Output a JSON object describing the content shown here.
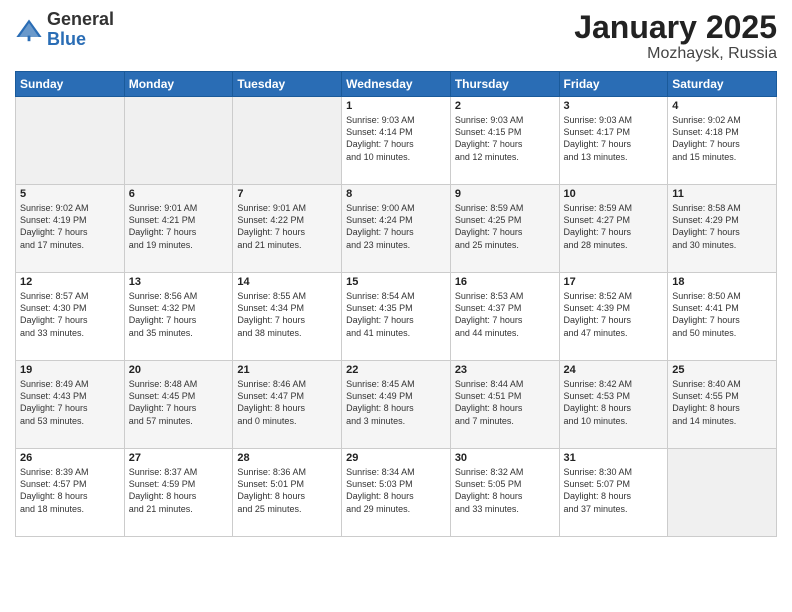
{
  "header": {
    "logo_general": "General",
    "logo_blue": "Blue",
    "month": "January 2025",
    "location": "Mozhaysk, Russia"
  },
  "weekdays": [
    "Sunday",
    "Monday",
    "Tuesday",
    "Wednesday",
    "Thursday",
    "Friday",
    "Saturday"
  ],
  "weeks": [
    [
      {
        "day": "",
        "info": ""
      },
      {
        "day": "",
        "info": ""
      },
      {
        "day": "",
        "info": ""
      },
      {
        "day": "1",
        "info": "Sunrise: 9:03 AM\nSunset: 4:14 PM\nDaylight: 7 hours\nand 10 minutes."
      },
      {
        "day": "2",
        "info": "Sunrise: 9:03 AM\nSunset: 4:15 PM\nDaylight: 7 hours\nand 12 minutes."
      },
      {
        "day": "3",
        "info": "Sunrise: 9:03 AM\nSunset: 4:17 PM\nDaylight: 7 hours\nand 13 minutes."
      },
      {
        "day": "4",
        "info": "Sunrise: 9:02 AM\nSunset: 4:18 PM\nDaylight: 7 hours\nand 15 minutes."
      }
    ],
    [
      {
        "day": "5",
        "info": "Sunrise: 9:02 AM\nSunset: 4:19 PM\nDaylight: 7 hours\nand 17 minutes."
      },
      {
        "day": "6",
        "info": "Sunrise: 9:01 AM\nSunset: 4:21 PM\nDaylight: 7 hours\nand 19 minutes."
      },
      {
        "day": "7",
        "info": "Sunrise: 9:01 AM\nSunset: 4:22 PM\nDaylight: 7 hours\nand 21 minutes."
      },
      {
        "day": "8",
        "info": "Sunrise: 9:00 AM\nSunset: 4:24 PM\nDaylight: 7 hours\nand 23 minutes."
      },
      {
        "day": "9",
        "info": "Sunrise: 8:59 AM\nSunset: 4:25 PM\nDaylight: 7 hours\nand 25 minutes."
      },
      {
        "day": "10",
        "info": "Sunrise: 8:59 AM\nSunset: 4:27 PM\nDaylight: 7 hours\nand 28 minutes."
      },
      {
        "day": "11",
        "info": "Sunrise: 8:58 AM\nSunset: 4:29 PM\nDaylight: 7 hours\nand 30 minutes."
      }
    ],
    [
      {
        "day": "12",
        "info": "Sunrise: 8:57 AM\nSunset: 4:30 PM\nDaylight: 7 hours\nand 33 minutes."
      },
      {
        "day": "13",
        "info": "Sunrise: 8:56 AM\nSunset: 4:32 PM\nDaylight: 7 hours\nand 35 minutes."
      },
      {
        "day": "14",
        "info": "Sunrise: 8:55 AM\nSunset: 4:34 PM\nDaylight: 7 hours\nand 38 minutes."
      },
      {
        "day": "15",
        "info": "Sunrise: 8:54 AM\nSunset: 4:35 PM\nDaylight: 7 hours\nand 41 minutes."
      },
      {
        "day": "16",
        "info": "Sunrise: 8:53 AM\nSunset: 4:37 PM\nDaylight: 7 hours\nand 44 minutes."
      },
      {
        "day": "17",
        "info": "Sunrise: 8:52 AM\nSunset: 4:39 PM\nDaylight: 7 hours\nand 47 minutes."
      },
      {
        "day": "18",
        "info": "Sunrise: 8:50 AM\nSunset: 4:41 PM\nDaylight: 7 hours\nand 50 minutes."
      }
    ],
    [
      {
        "day": "19",
        "info": "Sunrise: 8:49 AM\nSunset: 4:43 PM\nDaylight: 7 hours\nand 53 minutes."
      },
      {
        "day": "20",
        "info": "Sunrise: 8:48 AM\nSunset: 4:45 PM\nDaylight: 7 hours\nand 57 minutes."
      },
      {
        "day": "21",
        "info": "Sunrise: 8:46 AM\nSunset: 4:47 PM\nDaylight: 8 hours\nand 0 minutes."
      },
      {
        "day": "22",
        "info": "Sunrise: 8:45 AM\nSunset: 4:49 PM\nDaylight: 8 hours\nand 3 minutes."
      },
      {
        "day": "23",
        "info": "Sunrise: 8:44 AM\nSunset: 4:51 PM\nDaylight: 8 hours\nand 7 minutes."
      },
      {
        "day": "24",
        "info": "Sunrise: 8:42 AM\nSunset: 4:53 PM\nDaylight: 8 hours\nand 10 minutes."
      },
      {
        "day": "25",
        "info": "Sunrise: 8:40 AM\nSunset: 4:55 PM\nDaylight: 8 hours\nand 14 minutes."
      }
    ],
    [
      {
        "day": "26",
        "info": "Sunrise: 8:39 AM\nSunset: 4:57 PM\nDaylight: 8 hours\nand 18 minutes."
      },
      {
        "day": "27",
        "info": "Sunrise: 8:37 AM\nSunset: 4:59 PM\nDaylight: 8 hours\nand 21 minutes."
      },
      {
        "day": "28",
        "info": "Sunrise: 8:36 AM\nSunset: 5:01 PM\nDaylight: 8 hours\nand 25 minutes."
      },
      {
        "day": "29",
        "info": "Sunrise: 8:34 AM\nSunset: 5:03 PM\nDaylight: 8 hours\nand 29 minutes."
      },
      {
        "day": "30",
        "info": "Sunrise: 8:32 AM\nSunset: 5:05 PM\nDaylight: 8 hours\nand 33 minutes."
      },
      {
        "day": "31",
        "info": "Sunrise: 8:30 AM\nSunset: 5:07 PM\nDaylight: 8 hours\nand 37 minutes."
      },
      {
        "day": "",
        "info": ""
      }
    ]
  ]
}
